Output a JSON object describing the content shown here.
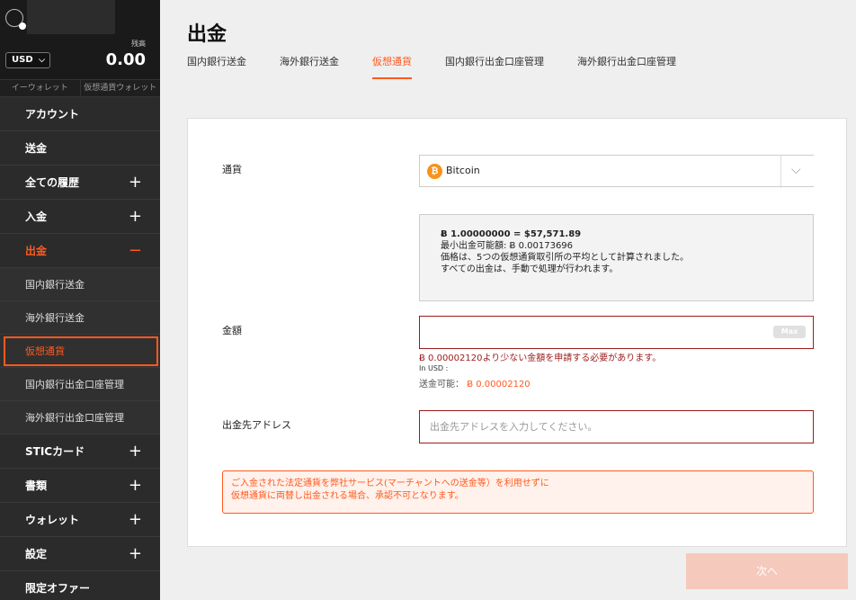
{
  "sidebar": {
    "currency": "USD",
    "balance_label": "残高",
    "balance_value": "0.00",
    "wallet_tabs": [
      "イーウォレット",
      "仮想通貨ウォレット"
    ],
    "menu": [
      {
        "label": "アカウント"
      },
      {
        "label": "送金"
      },
      {
        "label": "全ての履歴",
        "toggle": "+"
      },
      {
        "label": "入金",
        "toggle": "+"
      },
      {
        "label": "出金",
        "toggle": "−"
      }
    ],
    "submenu": [
      "国内銀行送金",
      "海外銀行送金",
      "仮想通貨",
      "国内銀行出金口座管理",
      "海外銀行出金口座管理"
    ],
    "menu_after": [
      {
        "label": "STICカード",
        "toggle": "+"
      },
      {
        "label": "書類",
        "toggle": "+"
      },
      {
        "label": "ウォレット",
        "toggle": "+"
      },
      {
        "label": "設定",
        "toggle": "+"
      },
      {
        "label": "限定オファー"
      }
    ]
  },
  "main": {
    "title": "出金",
    "tabs": [
      "国内銀行送金",
      "海外銀行送金",
      "仮想通貨",
      "国内銀行出金口座管理",
      "海外銀行出金口座管理"
    ],
    "form": {
      "currency_label": "通貨",
      "currency_value": "Bitcoin",
      "currency_icon": "₿",
      "rate_line": "Ƀ 1.00000000 = $57,571.89",
      "min_line": "最小出金可能額: Ƀ 0.00173696",
      "note_1": "価格は、5つの仮想通貨取引所の平均として計算されました。",
      "note_2": "すべての出金は、手動で処理が行われます。",
      "amount_label": "金額",
      "max_label": "Max",
      "amount_error": "Ƀ 0.00002120より少ない金額を申請する必要があります。",
      "in_usd": "In USD :",
      "available_label": "送金可能：",
      "available_value": "Ƀ 0.00002120",
      "address_label": "出金先アドレス",
      "address_placeholder": "出金先アドレスを入力してください。",
      "warning_1": "ご入金された法定通貨を弊社サービス(マーチャントへの送金等）を利用せずに",
      "warning_2": "仮想通貨に両替し出金される場合、承認不可となります。",
      "next_label": "次へ"
    }
  },
  "colors": {
    "accent": "#ff5a1f",
    "error": "#9b1c1c",
    "sidebar_bg": "#262626"
  }
}
